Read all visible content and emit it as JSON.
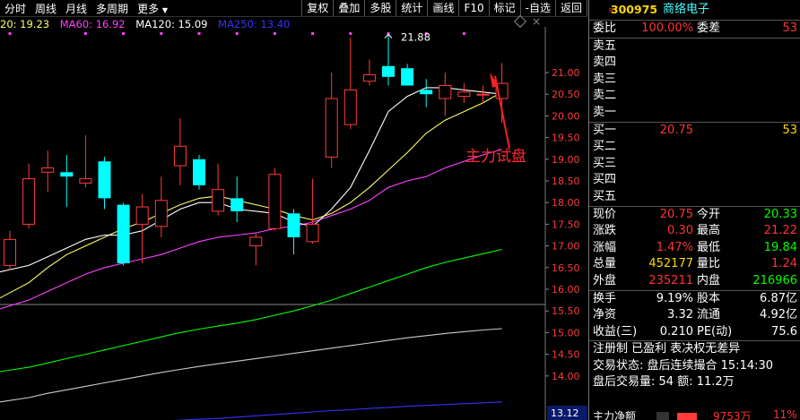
{
  "toolbar": {
    "left_items": [
      "分时",
      "周线",
      "月线",
      "多周期",
      "更多"
    ],
    "right_buttons": [
      "复权",
      "叠加",
      "多股",
      "统计",
      "画线",
      "F10",
      "标记",
      "-自选",
      "返回"
    ]
  },
  "ma_legend": [
    {
      "label": "20: 19.23",
      "color": "#ffff66"
    },
    {
      "label": "MA60: 16.92",
      "color": "#ff40ff"
    },
    {
      "label": "MA120: 15.09",
      "color": "#ffffff"
    },
    {
      "label": "MA250: 13.40",
      "color": "#3333ff"
    }
  ],
  "chart": {
    "y_ticks": [
      "21.00",
      "20.50",
      "20.00",
      "19.50",
      "19.00",
      "18.50",
      "18.00",
      "17.50",
      "17.00",
      "16.50",
      "16.00",
      "15.50",
      "15.00",
      "14.50",
      "14.00"
    ],
    "high_label": "21.88",
    "annotation": "主力试盘",
    "bottom_label": "13.12",
    "colors": {
      "up": "#ff3b3b",
      "down": "#00ffff",
      "ma5": "#ffffff",
      "ma10": "#ffff66",
      "ma20": "#ff40ff",
      "ma60": "#00ff00",
      "ma120": "#cccccc",
      "ma250": "#3333ff"
    },
    "candles": [
      {
        "o": 16.55,
        "c": 17.15,
        "h": 17.35,
        "l": 16.45
      },
      {
        "o": 17.5,
        "c": 18.55,
        "h": 18.9,
        "l": 17.4
      },
      {
        "o": 18.7,
        "c": 18.8,
        "h": 19.2,
        "l": 18.25
      },
      {
        "o": 18.7,
        "c": 18.6,
        "h": 19.1,
        "l": 17.9
      },
      {
        "o": 18.45,
        "c": 18.55,
        "h": 19.55,
        "l": 18.35
      },
      {
        "o": 18.95,
        "c": 18.1,
        "h": 19.05,
        "l": 17.85
      },
      {
        "o": 17.95,
        "c": 16.6,
        "h": 18.0,
        "l": 16.55
      },
      {
        "o": 17.5,
        "c": 17.9,
        "h": 18.2,
        "l": 16.6
      },
      {
        "o": 17.45,
        "c": 18.05,
        "h": 18.6,
        "l": 17.2
      },
      {
        "o": 18.85,
        "c": 19.3,
        "h": 19.95,
        "l": 18.4
      },
      {
        "o": 19.0,
        "c": 18.4,
        "h": 19.1,
        "l": 18.3
      },
      {
        "o": 17.8,
        "c": 18.3,
        "h": 18.9,
        "l": 17.7
      },
      {
        "o": 18.1,
        "c": 17.8,
        "h": 18.6,
        "l": 17.55
      },
      {
        "o": 17.0,
        "c": 17.2,
        "h": 17.3,
        "l": 16.55
      },
      {
        "o": 17.4,
        "c": 18.65,
        "h": 18.8,
        "l": 17.35
      },
      {
        "o": 17.75,
        "c": 17.2,
        "h": 17.85,
        "l": 16.8
      },
      {
        "o": 17.1,
        "c": 17.5,
        "h": 18.55,
        "l": 17.05
      },
      {
        "o": 19.05,
        "c": 20.4,
        "h": 21.0,
        "l": 18.8
      },
      {
        "o": 19.8,
        "c": 20.6,
        "h": 21.8,
        "l": 19.7
      },
      {
        "o": 20.8,
        "c": 20.95,
        "h": 21.3,
        "l": 20.7
      },
      {
        "o": 21.15,
        "c": 20.9,
        "h": 21.88,
        "l": 20.7
      },
      {
        "o": 21.1,
        "c": 20.7,
        "h": 21.2,
        "l": 20.7
      },
      {
        "o": 20.6,
        "c": 20.5,
        "h": 20.85,
        "l": 20.2
      },
      {
        "o": 20.4,
        "c": 20.7,
        "h": 21.0,
        "l": 20.0
      },
      {
        "o": 20.45,
        "c": 20.55,
        "h": 20.75,
        "l": 20.3
      },
      {
        "o": 20.5,
        "c": 20.5,
        "h": 20.7,
        "l": 20.3
      },
      {
        "o": 20.4,
        "c": 20.75,
        "h": 21.22,
        "l": 19.84
      }
    ],
    "ma5": [
      16.4,
      16.55,
      16.75,
      16.95,
      17.15,
      17.25,
      17.25,
      17.35,
      17.6,
      17.85,
      18.0,
      18.0,
      17.85,
      17.8,
      17.75,
      17.55,
      17.45,
      17.85,
      18.35,
      19.2,
      20.1,
      20.45,
      20.65,
      20.65,
      20.6,
      20.55,
      20.5
    ],
    "ma10": [
      15.8,
      16.15,
      16.5,
      16.8,
      17.0,
      17.2,
      17.4,
      17.55,
      17.75,
      17.95,
      18.1,
      18.15,
      18.05,
      17.95,
      17.85,
      17.7,
      17.6,
      17.75,
      18.0,
      18.35,
      18.75,
      19.15,
      19.6,
      19.9,
      20.1,
      20.3,
      20.55
    ],
    "ma20": [
      15.55,
      15.75,
      15.95,
      16.15,
      16.35,
      16.5,
      16.6,
      16.7,
      16.8,
      16.95,
      17.1,
      17.2,
      17.25,
      17.3,
      17.4,
      17.45,
      17.55,
      17.7,
      17.85,
      18.05,
      18.35,
      18.5,
      18.6,
      18.8,
      18.95,
      19.1,
      19.23
    ],
    "ma60": [
      14.1,
      14.2,
      14.3,
      14.4,
      14.5,
      14.6,
      14.7,
      14.8,
      14.9,
      15.0,
      15.08,
      15.15,
      15.22,
      15.3,
      15.4,
      15.5,
      15.62,
      15.75,
      15.9,
      16.05,
      16.2,
      16.35,
      16.5,
      16.62,
      16.72,
      16.82,
      16.92
    ],
    "ma120": [
      13.4,
      13.5,
      13.6,
      13.68,
      13.76,
      13.84,
      13.92,
      14.0,
      14.08,
      14.15,
      14.22,
      14.28,
      14.34,
      14.4,
      14.46,
      14.52,
      14.58,
      14.64,
      14.7,
      14.76,
      14.82,
      14.88,
      14.93,
      14.98,
      15.02,
      15.06,
      15.09
    ],
    "ma250": [
      12.8,
      12.82,
      12.84,
      12.86,
      12.88,
      12.9,
      12.92,
      12.94,
      12.96,
      12.98,
      13.0,
      13.02,
      13.05,
      13.08,
      13.11,
      13.14,
      13.17,
      13.2,
      13.22,
      13.25,
      13.27,
      13.3,
      13.32,
      13.34,
      13.36,
      13.38,
      13.4
    ]
  },
  "quote": {
    "code": "300975",
    "badge": "R",
    "name": "商络电子",
    "weibi_label": "委比",
    "weibi_val": "100.00%",
    "weicha_label": "委差",
    "weicha_val": "53",
    "sells": [
      "卖五",
      "卖四",
      "卖三",
      "卖二",
      "卖一"
    ],
    "buys": [
      {
        "label": "买一",
        "price": "20.75",
        "vol": "53"
      },
      {
        "label": "买二",
        "price": "",
        "vol": ""
      },
      {
        "label": "买三",
        "price": "",
        "vol": ""
      },
      {
        "label": "买四",
        "price": "",
        "vol": ""
      },
      {
        "label": "买五",
        "price": "",
        "vol": ""
      }
    ],
    "stats": [
      {
        "l1": "现价",
        "v1": "20.75",
        "c1": "red",
        "l2": "今开",
        "v2": "20.33",
        "c2": "green"
      },
      {
        "l1": "涨跌",
        "v1": "0.30",
        "c1": "red",
        "l2": "最高",
        "v2": "21.22",
        "c2": "red"
      },
      {
        "l1": "涨幅",
        "v1": "1.47%",
        "c1": "red",
        "l2": "最低",
        "v2": "19.84",
        "c2": "green"
      },
      {
        "l1": "总量",
        "v1": "452177",
        "c1": "yellow",
        "l2": "量比",
        "v2": "1.24",
        "c2": "red"
      },
      {
        "l1": "外盘",
        "v1": "235211",
        "c1": "red",
        "l2": "内盘",
        "v2": "216966",
        "c2": "green"
      }
    ],
    "stats2": [
      {
        "l1": "换手",
        "v1": "9.19%",
        "l2": "股本",
        "v2": "6.87亿"
      },
      {
        "l1": "净资",
        "v1": "3.32",
        "l2": "流通",
        "v2": "4.92亿"
      },
      {
        "l1": "收益(三)",
        "v1": "0.210",
        "l2": "PE(动)",
        "v2": "75.6"
      }
    ],
    "note1": "注册制 已盈利 表决权无差异",
    "note2": "交易状态: 盘后连续撮合 15:14:30",
    "note3": "盘后交易量: 54  额: 11.2万",
    "bottom_label": "主力净额",
    "bottom_val": "9753万",
    "bottom_pct": "11%"
  }
}
